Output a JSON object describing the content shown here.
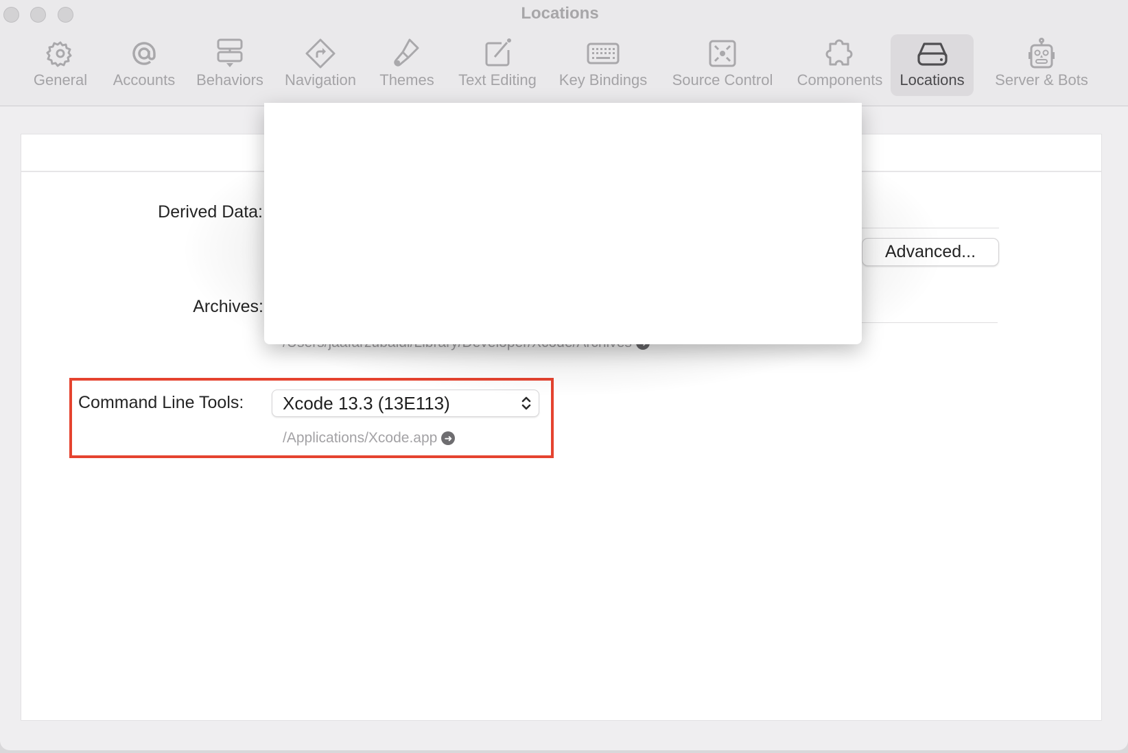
{
  "window": {
    "title": "Locations",
    "traffic_lights": [
      "close",
      "minimize",
      "zoom"
    ]
  },
  "toolbar": {
    "tabs": [
      {
        "label": "General",
        "icon": "gear-icon",
        "selected": false
      },
      {
        "label": "Accounts",
        "icon": "at-sign-icon",
        "selected": false
      },
      {
        "label": "Behaviors",
        "icon": "behaviors-icon",
        "selected": false
      },
      {
        "label": "Navigation",
        "icon": "navigation-sign-icon",
        "selected": false
      },
      {
        "label": "Themes",
        "icon": "paintbrush-icon",
        "selected": false
      },
      {
        "label": "Text Editing",
        "icon": "square-pencil-icon",
        "selected": false
      },
      {
        "label": "Key Bindings",
        "icon": "keyboard-icon",
        "selected": false
      },
      {
        "label": "Source Control",
        "icon": "source-control-icon",
        "selected": false
      },
      {
        "label": "Components",
        "icon": "puzzle-piece-icon",
        "selected": false
      },
      {
        "label": "Locations",
        "icon": "hard-drive-icon",
        "selected": true
      },
      {
        "label": "Server & Bots",
        "icon": "robot-icon",
        "selected": false
      }
    ]
  },
  "locations": {
    "derived_data_label": "Derived Data:",
    "advanced_button": "Advanced...",
    "archives_label": "Archives:",
    "archives_path": "/Users/jaafarzubaidi/Library/Developer/Xcode/Archives",
    "command_line_tools_label": "Command Line Tools:",
    "command_line_tools_value": "Xcode 13.3 (13E113)",
    "command_line_tools_path": "/Applications/Xcode.app",
    "reveal_arrow": "➜"
  },
  "colors": {
    "highlight": "#e5432f",
    "selected_tab_bg": "#dcdadd"
  }
}
